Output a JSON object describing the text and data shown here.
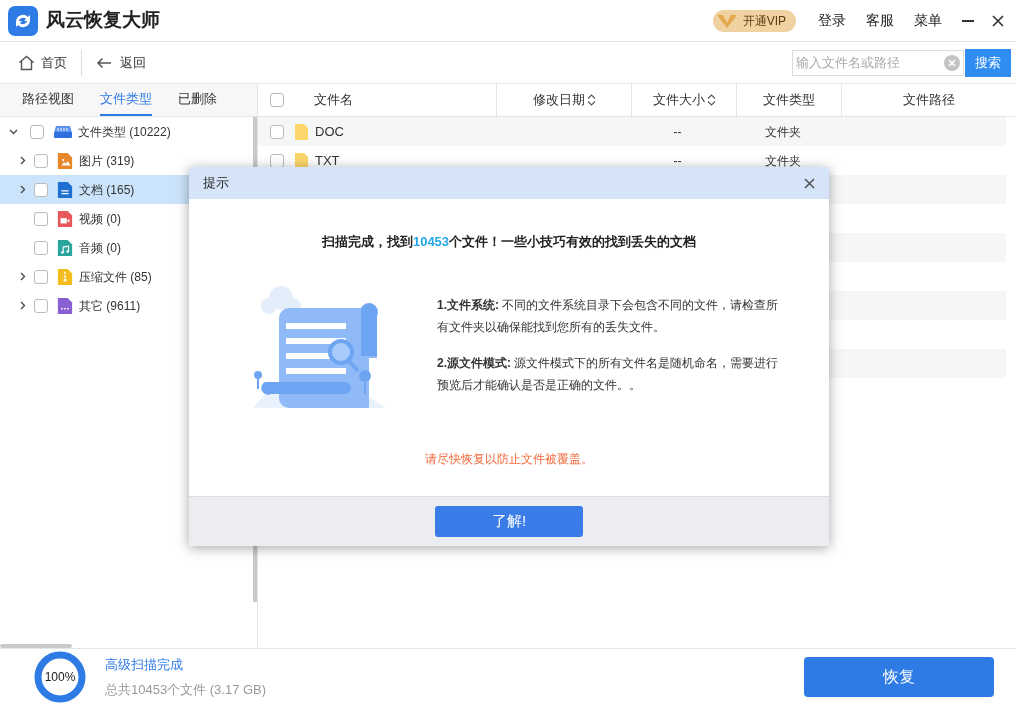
{
  "app": {
    "title": "风云恢复大师",
    "vip": "开通VIP",
    "menu": [
      "登录",
      "客服",
      "菜单"
    ]
  },
  "toolbar": {
    "home": "首页",
    "back": "返回",
    "search": {
      "placeholder": "输入文件名或路径",
      "button": "搜索"
    }
  },
  "left_tabs": [
    {
      "label": "路径视图",
      "selected": false
    },
    {
      "label": "文件类型",
      "selected": true
    },
    {
      "label": "已删除",
      "selected": false
    }
  ],
  "tree": {
    "label": "文件类型 (10222)",
    "checked": false,
    "expanded": true,
    "children": [
      {
        "label": "图片 (319)",
        "kind": "image",
        "color": "#e8872a",
        "expandable": true,
        "checked": false,
        "selected": false
      },
      {
        "label": "文档 (165)",
        "kind": "document",
        "color": "#1f6fd0",
        "expandable": true,
        "checked": false,
        "selected": true
      },
      {
        "label": "视频 (0)",
        "kind": "video",
        "color": "#e9575a",
        "expandable": false,
        "checked": false,
        "selected": false
      },
      {
        "label": "音频 (0)",
        "kind": "audio",
        "color": "#2aa59b",
        "expandable": false,
        "checked": false,
        "selected": false
      },
      {
        "label": "压缩文件 (85)",
        "kind": "archive",
        "color": "#f3bd1f",
        "expandable": true,
        "checked": false,
        "selected": false
      },
      {
        "label": "其它 (9611)",
        "kind": "other",
        "color": "#8a5fd4",
        "expandable": true,
        "checked": false,
        "selected": false
      }
    ]
  },
  "table": {
    "all_checked": false,
    "columns": [
      {
        "label": "文件名",
        "sortable": false
      },
      {
        "label": "修改日期",
        "sortable": true
      },
      {
        "label": "文件大小",
        "sortable": true
      },
      {
        "label": "文件类型",
        "sortable": false
      },
      {
        "label": "文件路径",
        "sortable": false
      }
    ],
    "rows": [
      {
        "name": "DOC",
        "size": "--",
        "type": "文件夹",
        "checked": false
      },
      {
        "name": "TXT",
        "size": "--",
        "type": "文件夹",
        "checked": false
      }
    ]
  },
  "dialog": {
    "title": "提示",
    "headline_before": "扫描完成，找到",
    "headline_count": "10453",
    "headline_after": "个文件！一些小技巧有效的找到丢失的文档",
    "tips": [
      "**1.文件系统:** 不同的文件系统目录下会包含不同的文件，请检查所有文件夹以确保能找到您所有的丢失文件。",
      "**2.源文件模式:** 源文件模式下的所有文件名是随机命名，需要进行预览后才能确认是否是正确的文件。。"
    ],
    "warning": "请尽快恢复以防止文件被覆盖。",
    "button": "了解!"
  },
  "status": {
    "progress_label": "100%",
    "level": 1,
    "title": "高级扫描完成",
    "summary": "总共10453个文件 (3.17 GB)",
    "recover": "恢复"
  }
}
